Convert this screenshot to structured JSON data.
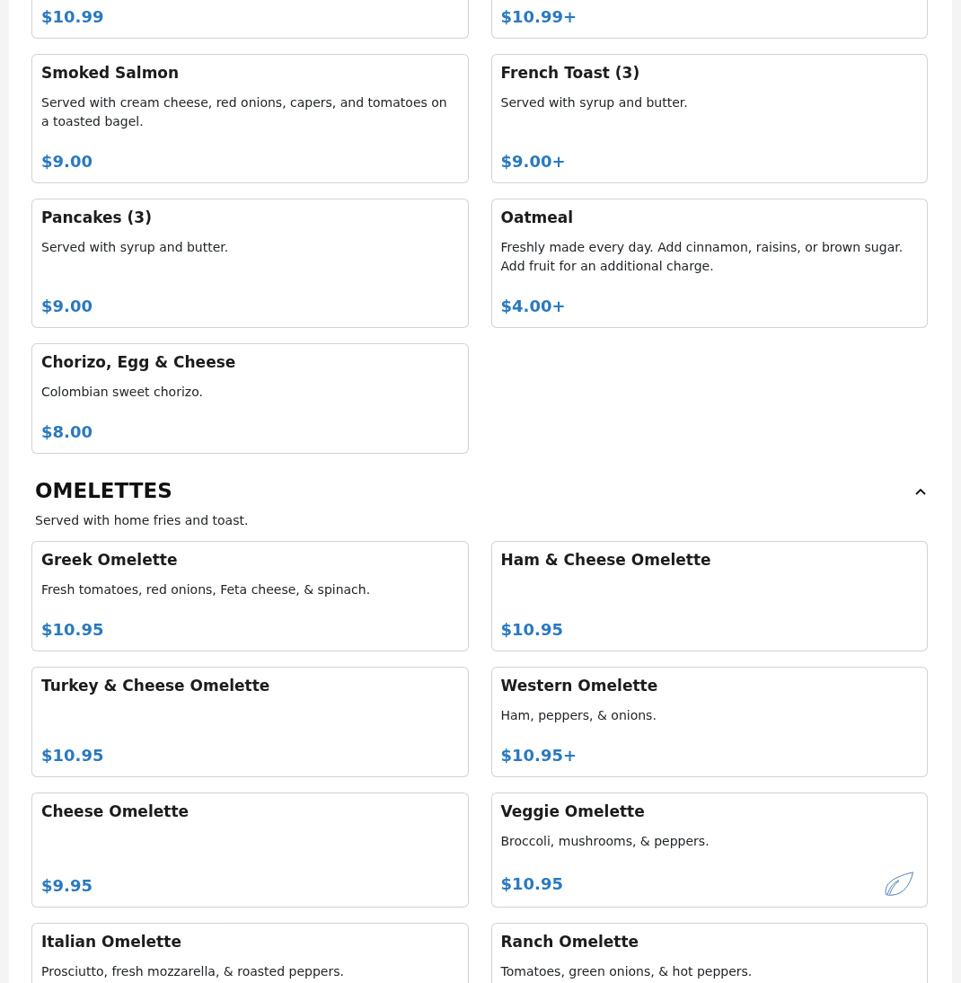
{
  "sections": [
    {
      "items": [
        {
          "price": "$10.99",
          "vegetarian": false
        },
        {
          "price": "$10.99+",
          "vegetarian": false
        },
        {
          "name": "Smoked Salmon",
          "description": "Served with cream cheese, red onions, capers, and tomatoes on a toasted bagel.",
          "price": "$9.00",
          "vegetarian": false
        },
        {
          "name": "French Toast (3)",
          "description": "Served with syrup and butter.",
          "price": "$9.00+",
          "vegetarian": false
        },
        {
          "name": "Pancakes (3)",
          "description": "Served with syrup and butter.",
          "price": "$9.00",
          "vegetarian": false
        },
        {
          "name": "Oatmeal",
          "description": "Freshly made every day. Add cinnamon, raisins, or brown sugar. Add fruit for an additional charge.",
          "price": "$4.00+",
          "vegetarian": false
        },
        {
          "name": "Chorizo, Egg & Cheese",
          "description": "Colombian sweet chorizo.",
          "price": "$8.00",
          "vegetarian": false
        }
      ]
    },
    {
      "title": "OMELETTES",
      "expanded": true,
      "subtitle": "Served with home fries and toast.",
      "items": [
        {
          "name": "Greek Omelette",
          "description": "Fresh tomatoes, red onions, Feta cheese, & spinach.",
          "price": "$10.95",
          "vegetarian": false
        },
        {
          "name": "Ham & Cheese Omelette",
          "price": "$10.95",
          "vegetarian": false
        },
        {
          "name": "Turkey & Cheese Omelette",
          "price": "$10.95",
          "vegetarian": false
        },
        {
          "name": "Western Omelette",
          "description": "Ham, peppers, & onions.",
          "price": "$10.95+",
          "vegetarian": false
        },
        {
          "name": "Cheese Omelette",
          "price": "$9.95",
          "vegetarian": false
        },
        {
          "name": "Veggie Omelette",
          "description": "Broccoli, mushrooms, & peppers.",
          "price": "$10.95",
          "vegetarian": true
        },
        {
          "name": "Italian Omelette",
          "description": "Prosciutto, fresh mozzarella, & roasted peppers."
        },
        {
          "name": "Ranch Omelette",
          "description": "Tomatoes, green onions, & hot peppers."
        }
      ]
    }
  ]
}
